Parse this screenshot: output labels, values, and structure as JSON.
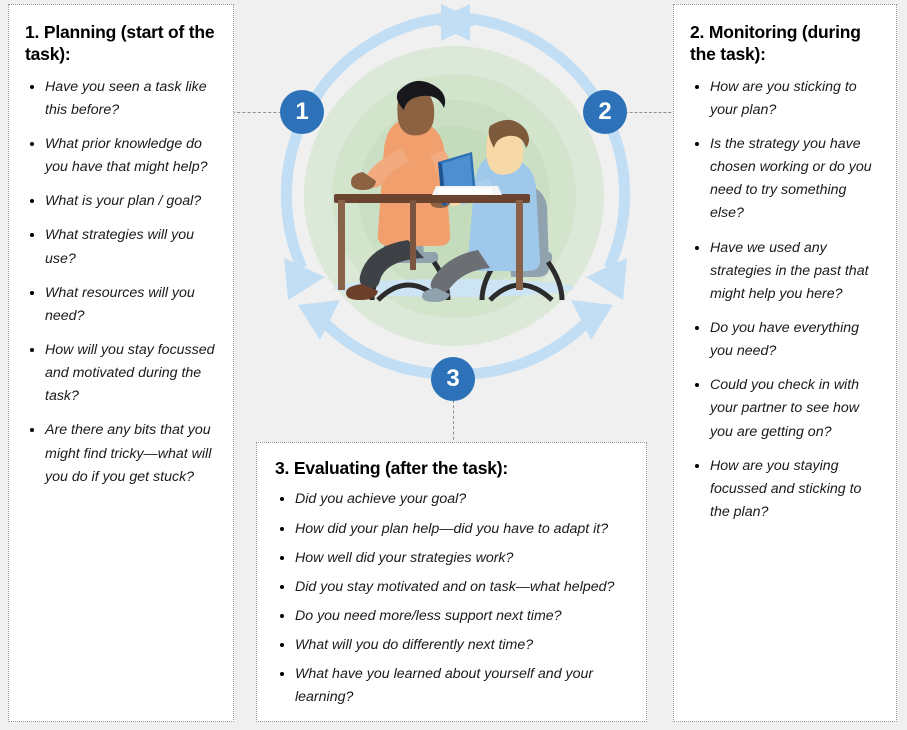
{
  "page": {
    "background_color": "#f0f0f0",
    "panel_background": "#ffffff",
    "accent_color": "#2d72b8",
    "arrow_color": "#c2def5",
    "illustration_halo_color": "#cfe3cb"
  },
  "diagram": {
    "badges": [
      {
        "id": "badge-1",
        "label": "1"
      },
      {
        "id": "badge-2",
        "label": "2"
      },
      {
        "id": "badge-3",
        "label": "3"
      }
    ],
    "illustration_name": "two-people-at-desk-illustration"
  },
  "panels": {
    "planning": {
      "title": "1. Planning (start of the task):",
      "items": [
        "Have you seen a task like this before?",
        "What prior knowledge do you have that might help?",
        "What is your plan / goal?",
        "What strategies will you use?",
        "What resources will you need?",
        "How will you stay focussed and motivated during the task?",
        "Are there any bits that you might find tricky—what will you do if you get stuck?"
      ]
    },
    "monitoring": {
      "title": "2. Monitoring (during the task):",
      "items": [
        "How are you sticking to your plan?",
        "Is the strategy you have chosen working or do you need to try something else?",
        "Have we used any strategies in the past that might help you here?",
        "Do you have everything you need?",
        "Could you check in with your partner to see how you are getting on?",
        "How are you staying focussed and sticking to the plan?"
      ]
    },
    "evaluating": {
      "title": "3. Evaluating (after the task):",
      "items": [
        "Did you achieve your goal?",
        "How did your plan help—did you have to adapt it?",
        "How well did your strategies work?",
        "Did you stay motivated and on task—what helped?",
        "Do you need more/less support next time?",
        "What will you do differently next time?",
        "What have you learned about yourself and your learning?"
      ]
    }
  }
}
